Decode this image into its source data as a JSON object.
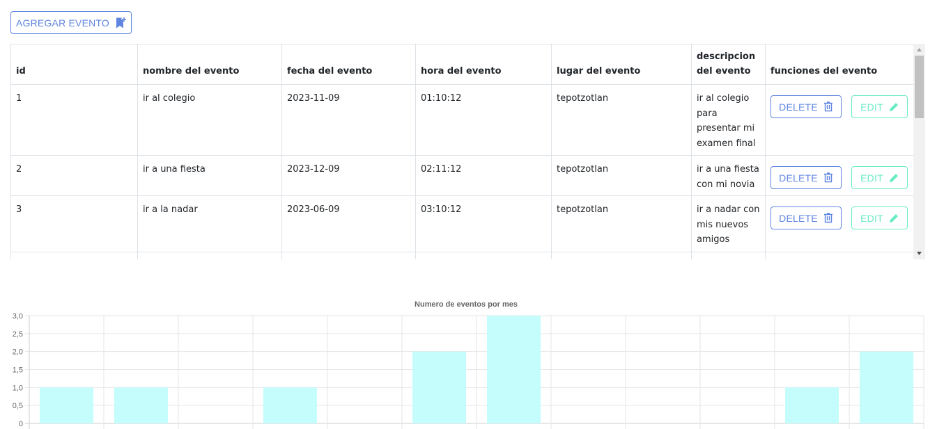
{
  "toolbar": {
    "add_label": "AGREGAR EVENTO",
    "add_icon": "bookmark-plus-icon"
  },
  "table": {
    "headers": [
      "id",
      "nombre del evento",
      "fecha del evento",
      "hora del evento",
      "lugar del evento",
      "descripcion del evento",
      "funciones del evento"
    ],
    "rows": [
      {
        "id": "1",
        "nombre": "ir al colegio",
        "fecha": "2023-11-09",
        "hora": "01:10:12",
        "lugar": "tepotzotlan",
        "descripcion": "ir al colegio para presentar mi examen final"
      },
      {
        "id": "2",
        "nombre": "ir a una fiesta",
        "fecha": "2023-12-09",
        "hora": "02:11:12",
        "lugar": "tepotzotlan",
        "descripcion": "ir a una fiesta con mi novia"
      },
      {
        "id": "3",
        "nombre": "ir a la nadar",
        "fecha": "2023-06-09",
        "hora": "03:10:12",
        "lugar": "tepotzotlan",
        "descripcion": "ir a nadar con mis nuevos amigos"
      }
    ],
    "delete_label": "DELETE",
    "edit_label": "EDIT",
    "delete_icon": "trash-icon",
    "edit_icon": "pencil-icon",
    "colors": {
      "delete": "#5f85e0",
      "edit": "#69ebc6",
      "border": "#dee2e6"
    }
  },
  "chart_data": {
    "type": "bar",
    "title": "Numero de eventos por mes",
    "categories": [
      "",
      "",
      "",
      "",
      "",
      "",
      "",
      "",
      "",
      "",
      "",
      ""
    ],
    "values": [
      1,
      1,
      0,
      1,
      0,
      2,
      3,
      0,
      0,
      0,
      1,
      2
    ],
    "ylim": [
      0,
      3
    ],
    "yticks": [
      "0",
      "0,5",
      "1,0",
      "1,5",
      "2,0",
      "2,5",
      "3,0"
    ],
    "bar_color": "#c5fcfc",
    "grid": true
  }
}
